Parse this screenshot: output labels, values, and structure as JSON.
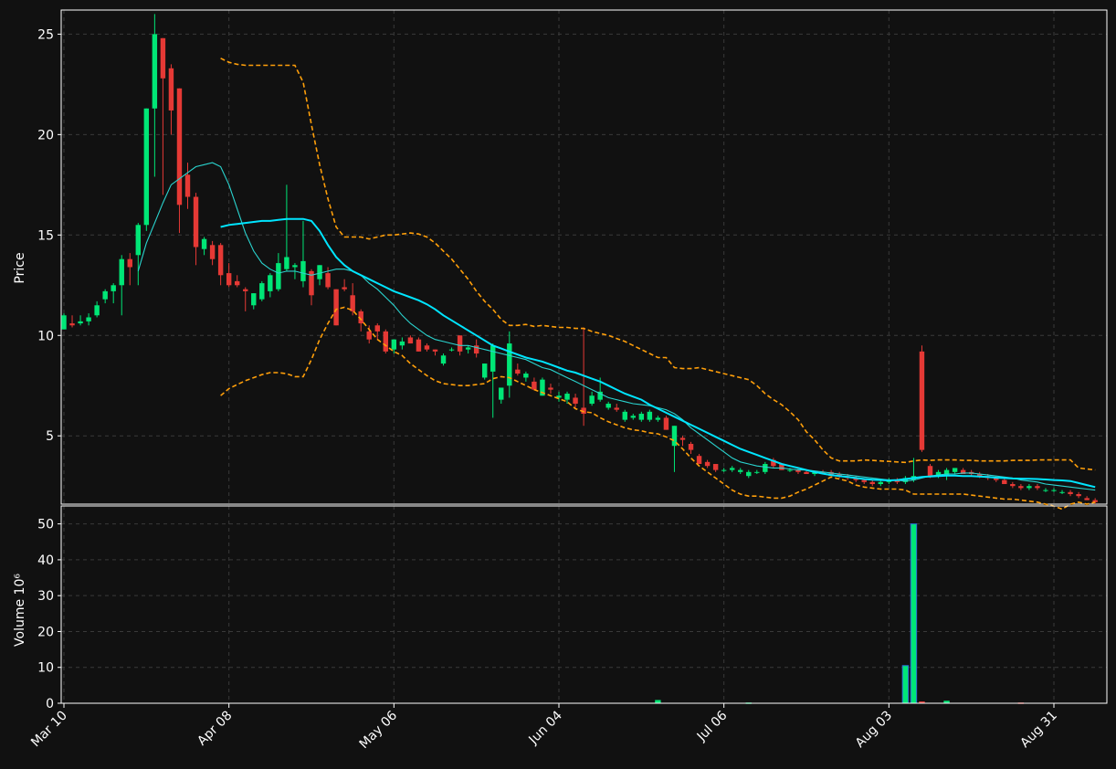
{
  "colors": {
    "background": "#111111",
    "up": "#00e676",
    "down": "#e53935",
    "ma_short": "#2ad4cf",
    "ma_long": "#00e5ff",
    "bands": "#ff9f0a",
    "grid": "#3a3a3a",
    "axis": "#ffffff"
  },
  "chart_data": [
    {
      "type": "candlestick",
      "title": "",
      "ylabel": "Price",
      "ylim": [
        1.6,
        26.2
      ],
      "yticks": [
        5,
        10,
        15,
        20,
        25
      ],
      "x_tick_labels": [
        "Mar 10",
        "Apr 08",
        "May 06",
        "Jun 04",
        "Jul 06",
        "Aug 03",
        "Aug 31"
      ],
      "x_tick_index": [
        0,
        20,
        40,
        60,
        80,
        100,
        120
      ],
      "grid": true,
      "candles": [
        [
          10.3,
          11.1,
          10.3,
          11.0
        ],
        [
          10.6,
          11.0,
          10.4,
          10.5
        ],
        [
          10.6,
          11.0,
          10.5,
          10.7
        ],
        [
          10.7,
          11.1,
          10.5,
          10.9
        ],
        [
          11.0,
          11.7,
          10.9,
          11.5
        ],
        [
          11.8,
          12.3,
          11.6,
          12.2
        ],
        [
          12.2,
          12.6,
          11.6,
          12.5
        ],
        [
          12.5,
          14.0,
          11.0,
          13.8
        ],
        [
          13.8,
          14.1,
          12.5,
          13.4
        ],
        [
          14.0,
          15.6,
          12.5,
          15.5
        ],
        [
          15.5,
          21.3,
          15.2,
          21.3
        ],
        [
          21.3,
          26.0,
          17.9,
          25.0
        ],
        [
          24.8,
          24.8,
          17.0,
          22.8
        ],
        [
          23.3,
          23.5,
          20.0,
          21.2
        ],
        [
          22.3,
          22.3,
          15.1,
          16.5
        ],
        [
          18.0,
          18.6,
          16.3,
          16.9
        ],
        [
          16.9,
          17.1,
          13.5,
          14.4
        ],
        [
          14.3,
          14.9,
          14.0,
          14.8
        ],
        [
          14.5,
          14.7,
          13.5,
          13.8
        ],
        [
          14.5,
          14.6,
          12.5,
          13.0
        ],
        [
          13.1,
          13.6,
          12.4,
          12.5
        ],
        [
          12.7,
          13.0,
          12.4,
          12.5
        ],
        [
          12.3,
          12.4,
          11.2,
          12.2
        ],
        [
          11.5,
          12.1,
          11.3,
          12.1
        ],
        [
          11.8,
          12.7,
          11.7,
          12.6
        ],
        [
          12.2,
          13.1,
          11.9,
          13.0
        ],
        [
          12.3,
          14.1,
          12.2,
          13.6
        ],
        [
          13.3,
          17.5,
          13.2,
          13.9
        ],
        [
          13.4,
          13.6,
          12.8,
          13.5
        ],
        [
          12.7,
          15.7,
          12.4,
          13.7
        ],
        [
          13.2,
          13.3,
          11.5,
          12.0
        ],
        [
          12.8,
          13.5,
          12.5,
          13.5
        ],
        [
          13.1,
          13.4,
          12.3,
          12.4
        ],
        [
          12.3,
          12.3,
          10.5,
          10.5
        ],
        [
          12.4,
          12.8,
          12.2,
          12.3
        ],
        [
          12.0,
          12.6,
          11.0,
          11.2
        ],
        [
          11.2,
          11.3,
          10.2,
          10.6
        ],
        [
          10.2,
          10.5,
          9.6,
          9.8
        ],
        [
          10.5,
          10.6,
          9.8,
          10.2
        ],
        [
          10.2,
          10.3,
          9.1,
          9.2
        ],
        [
          9.3,
          9.8,
          9.1,
          9.8
        ],
        [
          9.5,
          9.9,
          9.3,
          9.7
        ],
        [
          9.9,
          10.0,
          9.6,
          9.6
        ],
        [
          9.8,
          9.9,
          9.2,
          9.2
        ],
        [
          9.5,
          9.6,
          9.2,
          9.3
        ],
        [
          9.3,
          9.3,
          9.0,
          9.2
        ],
        [
          8.6,
          9.1,
          8.5,
          9.0
        ],
        [
          9.3,
          9.4,
          9.2,
          9.3
        ],
        [
          10.0,
          10.0,
          9.0,
          9.2
        ],
        [
          9.3,
          9.5,
          9.1,
          9.4
        ],
        [
          9.5,
          9.8,
          8.9,
          9.1
        ],
        [
          7.9,
          8.6,
          7.8,
          8.6
        ],
        [
          8.2,
          9.6,
          5.9,
          9.5
        ],
        [
          6.8,
          7.0,
          6.6,
          7.4
        ],
        [
          7.5,
          10.2,
          6.9,
          9.6
        ],
        [
          8.3,
          8.6,
          8.0,
          8.1
        ],
        [
          7.9,
          8.2,
          7.7,
          8.1
        ],
        [
          7.7,
          7.9,
          7.3,
          7.3
        ],
        [
          7.0,
          7.9,
          7.0,
          7.8
        ],
        [
          7.4,
          7.6,
          7.1,
          7.3
        ],
        [
          6.9,
          7.2,
          6.7,
          7.0
        ],
        [
          6.8,
          7.2,
          6.6,
          7.1
        ],
        [
          6.9,
          7.1,
          6.4,
          6.6
        ],
        [
          6.4,
          10.4,
          5.5,
          6.1
        ],
        [
          6.6,
          7.2,
          6.5,
          7.0
        ],
        [
          6.8,
          7.9,
          6.7,
          7.2
        ],
        [
          6.4,
          6.7,
          6.3,
          6.6
        ],
        [
          6.4,
          6.6,
          6.2,
          6.3
        ],
        [
          5.8,
          6.3,
          5.7,
          6.2
        ],
        [
          5.9,
          6.1,
          5.8,
          6.0
        ],
        [
          5.8,
          6.2,
          5.7,
          6.1
        ],
        [
          5.8,
          6.3,
          5.7,
          6.2
        ],
        [
          5.8,
          6.0,
          5.7,
          5.9
        ],
        [
          5.9,
          6.0,
          5.3,
          5.3
        ],
        [
          4.5,
          5.5,
          3.2,
          5.5
        ],
        [
          4.9,
          5.0,
          4.5,
          4.8
        ],
        [
          4.6,
          4.7,
          4.1,
          4.3
        ],
        [
          4.0,
          4.1,
          3.6,
          3.6
        ],
        [
          3.7,
          3.8,
          3.4,
          3.5
        ],
        [
          3.6,
          3.6,
          3.2,
          3.3
        ],
        [
          3.3,
          3.4,
          3.2,
          3.3
        ],
        [
          3.3,
          3.5,
          3.2,
          3.4
        ],
        [
          3.2,
          3.4,
          3.1,
          3.3
        ],
        [
          3.0,
          3.3,
          2.9,
          3.2
        ],
        [
          3.2,
          3.3,
          3.1,
          3.2
        ],
        [
          3.2,
          3.7,
          3.1,
          3.6
        ],
        [
          3.8,
          3.9,
          3.4,
          3.5
        ],
        [
          3.6,
          3.6,
          3.3,
          3.3
        ],
        [
          3.3,
          3.4,
          3.2,
          3.3
        ],
        [
          3.3,
          3.4,
          3.1,
          3.2
        ],
        [
          3.2,
          3.3,
          3.1,
          3.1
        ],
        [
          3.1,
          3.2,
          3.0,
          3.2
        ],
        [
          3.2,
          3.3,
          3.1,
          3.1
        ],
        [
          3.2,
          3.3,
          3.0,
          3.0
        ],
        [
          3.1,
          3.2,
          2.9,
          3.0
        ],
        [
          3.0,
          3.1,
          2.8,
          2.9
        ],
        [
          2.9,
          3.0,
          2.7,
          2.8
        ],
        [
          2.8,
          2.9,
          2.6,
          2.7
        ],
        [
          2.7,
          2.8,
          2.5,
          2.6
        ],
        [
          2.6,
          2.8,
          2.5,
          2.7
        ],
        [
          2.7,
          2.9,
          2.6,
          2.8
        ],
        [
          2.8,
          2.9,
          2.6,
          2.7
        ],
        [
          2.7,
          3.0,
          2.6,
          2.9
        ],
        [
          2.8,
          3.9,
          2.7,
          3.0
        ],
        [
          9.2,
          9.5,
          4.2,
          4.3
        ],
        [
          3.5,
          3.6,
          2.9,
          3.0
        ],
        [
          3.0,
          3.3,
          2.9,
          3.2
        ],
        [
          3.0,
          3.4,
          2.8,
          3.3
        ],
        [
          3.2,
          3.4,
          3.1,
          3.4
        ],
        [
          3.3,
          3.4,
          3.1,
          3.1
        ],
        [
          3.2,
          3.3,
          3.0,
          3.1
        ],
        [
          3.1,
          3.2,
          2.9,
          3.0
        ],
        [
          3.0,
          3.1,
          2.8,
          2.9
        ],
        [
          2.9,
          3.0,
          2.7,
          2.8
        ],
        [
          2.8,
          2.9,
          2.6,
          2.6
        ],
        [
          2.6,
          2.7,
          2.4,
          2.5
        ],
        [
          2.5,
          2.6,
          2.3,
          2.4
        ],
        [
          2.4,
          2.6,
          2.3,
          2.5
        ],
        [
          2.5,
          2.6,
          2.3,
          2.4
        ],
        [
          2.3,
          2.4,
          2.2,
          2.3
        ],
        [
          2.3,
          2.4,
          2.2,
          2.3
        ],
        [
          2.2,
          2.3,
          2.1,
          2.2
        ],
        [
          2.2,
          2.3,
          2.0,
          2.1
        ],
        [
          2.1,
          2.2,
          1.9,
          2.0
        ],
        [
          1.9,
          2.0,
          1.8,
          1.8
        ],
        [
          1.8,
          1.9,
          1.6,
          1.7
        ]
      ],
      "ma_short": [
        null,
        null,
        null,
        null,
        null,
        null,
        null,
        null,
        null,
        13.2,
        14.6,
        15.6,
        16.6,
        17.5,
        17.8,
        18.1,
        18.4,
        18.5,
        18.6,
        18.4,
        17.5,
        16.3,
        15.1,
        14.2,
        13.6,
        13.3,
        13.1,
        13.2,
        13.2,
        13.1,
        13.0,
        13.1,
        13.2,
        13.3,
        13.3,
        13.2,
        13.0,
        12.6,
        12.3,
        11.9,
        11.5,
        11.0,
        10.6,
        10.3,
        10.0,
        9.8,
        9.7,
        9.6,
        9.5,
        9.5,
        9.4,
        9.3,
        9.2,
        9.1,
        9.0,
        8.9,
        8.8,
        8.6,
        8.4,
        8.3,
        8.1,
        7.9,
        7.7,
        7.5,
        7.3,
        7.1,
        6.9,
        6.8,
        6.7,
        6.6,
        6.55,
        6.5,
        6.4,
        6.3,
        6.1,
        5.8,
        5.4,
        5.1,
        4.8,
        4.5,
        4.2,
        3.9,
        3.7,
        3.6,
        3.5,
        3.45,
        3.4,
        3.4,
        3.35,
        3.3,
        3.3,
        3.25,
        3.2,
        3.15,
        3.1,
        3.05,
        3.0,
        2.95,
        2.9,
        2.85,
        2.8,
        2.78,
        2.75,
        2.8,
        2.9,
        3.0,
        3.05,
        3.1,
        3.1,
        3.15,
        3.15,
        3.1,
        3.05,
        3.0,
        2.95,
        2.9,
        2.8,
        2.75,
        2.7,
        2.6,
        2.55,
        2.5,
        2.45,
        2.4,
        2.35,
        2.3
      ],
      "ma_long": [
        null,
        null,
        null,
        null,
        null,
        null,
        null,
        null,
        null,
        null,
        null,
        null,
        null,
        null,
        null,
        null,
        null,
        null,
        null,
        15.4,
        15.5,
        15.55,
        15.6,
        15.65,
        15.7,
        15.7,
        15.75,
        15.8,
        15.8,
        15.8,
        15.7,
        15.2,
        14.5,
        13.9,
        13.5,
        13.2,
        13.0,
        12.8,
        12.6,
        12.4,
        12.2,
        12.05,
        11.9,
        11.75,
        11.55,
        11.3,
        11.0,
        10.75,
        10.5,
        10.25,
        10.0,
        9.75,
        9.5,
        9.35,
        9.2,
        9.05,
        8.9,
        8.8,
        8.7,
        8.55,
        8.4,
        8.25,
        8.15,
        8.0,
        7.85,
        7.7,
        7.5,
        7.3,
        7.1,
        6.95,
        6.8,
        6.55,
        6.35,
        6.15,
        5.95,
        5.75,
        5.55,
        5.35,
        5.15,
        4.95,
        4.75,
        4.55,
        4.35,
        4.2,
        4.05,
        3.9,
        3.75,
        3.6,
        3.5,
        3.4,
        3.3,
        3.2,
        3.12,
        3.05,
        3.0,
        2.95,
        2.9,
        2.85,
        2.82,
        2.8,
        2.78,
        2.8,
        2.85,
        2.9,
        2.95,
        2.98,
        3.0,
        3.02,
        3.02,
        3.0,
        3.0,
        2.98,
        2.95,
        2.92,
        2.9,
        2.88,
        2.87,
        2.86,
        2.85,
        2.83,
        2.8,
        2.78,
        2.75,
        2.65,
        2.55,
        2.45
      ],
      "band_upper": [
        null,
        null,
        null,
        null,
        null,
        null,
        null,
        null,
        null,
        null,
        null,
        null,
        null,
        null,
        null,
        null,
        null,
        null,
        null,
        23.8,
        23.6,
        23.5,
        23.45,
        23.45,
        23.45,
        23.45,
        23.45,
        23.45,
        23.45,
        22.6,
        20.5,
        18.5,
        16.8,
        15.4,
        14.9,
        14.9,
        14.9,
        14.8,
        14.9,
        15.0,
        15.0,
        15.05,
        15.1,
        15.05,
        14.9,
        14.6,
        14.2,
        13.8,
        13.3,
        12.8,
        12.2,
        11.7,
        11.3,
        10.8,
        10.5,
        10.5,
        10.55,
        10.45,
        10.5,
        10.45,
        10.4,
        10.4,
        10.35,
        10.35,
        10.2,
        10.1,
        10.0,
        9.85,
        9.7,
        9.5,
        9.3,
        9.1,
        8.9,
        8.9,
        8.4,
        8.35,
        8.35,
        8.4,
        8.3,
        8.2,
        8.1,
        8.0,
        7.9,
        7.8,
        7.5,
        7.1,
        6.8,
        6.55,
        6.2,
        5.8,
        5.2,
        4.8,
        4.3,
        3.9,
        3.75,
        3.75,
        3.75,
        3.8,
        3.78,
        3.75,
        3.73,
        3.7,
        3.68,
        3.75,
        3.8,
        3.78,
        3.8,
        3.8,
        3.8,
        3.78,
        3.78,
        3.75,
        3.75,
        3.75,
        3.75,
        3.78,
        3.78,
        3.78,
        3.8,
        3.8,
        3.8,
        3.8,
        3.8,
        3.4,
        3.35,
        3.3
      ],
      "band_lower": [
        null,
        null,
        null,
        null,
        null,
        null,
        null,
        null,
        null,
        null,
        null,
        null,
        null,
        null,
        null,
        null,
        null,
        null,
        null,
        7.0,
        7.35,
        7.55,
        7.75,
        7.9,
        8.05,
        8.15,
        8.15,
        8.1,
        7.95,
        7.95,
        8.8,
        9.8,
        10.6,
        11.3,
        11.4,
        11.25,
        10.8,
        10.3,
        9.8,
        9.5,
        9.2,
        9.0,
        8.6,
        8.3,
        8.0,
        7.75,
        7.6,
        7.55,
        7.5,
        7.5,
        7.55,
        7.6,
        7.85,
        7.95,
        7.9,
        7.7,
        7.5,
        7.3,
        7.15,
        7.0,
        6.85,
        6.7,
        6.35,
        6.2,
        6.15,
        5.9,
        5.7,
        5.55,
        5.4,
        5.3,
        5.25,
        5.15,
        5.1,
        4.95,
        4.75,
        4.35,
        3.9,
        3.5,
        3.2,
        2.9,
        2.6,
        2.3,
        2.1,
        2.0,
        2.0,
        1.95,
        1.9,
        1.9,
        2.0,
        2.2,
        2.35,
        2.55,
        2.75,
        2.95,
        2.85,
        2.75,
        2.55,
        2.45,
        2.4,
        2.35,
        2.35,
        2.35,
        2.3,
        2.1,
        2.1,
        2.1,
        2.1,
        2.1,
        2.1,
        2.1,
        2.05,
        2.0,
        1.95,
        1.9,
        1.85,
        1.85,
        1.8,
        1.75,
        1.7,
        1.6,
        1.5,
        1.35,
        1.6,
        1.7,
        1.6,
        1.7
      ]
    },
    {
      "type": "bar",
      "ylabel": "Volume",
      "ylabel_exponent": "10⁶",
      "ylim": [
        0,
        50
      ],
      "yticks": [
        0,
        10,
        20,
        30,
        40,
        50
      ],
      "grid": true,
      "volumes": [
        [
          72,
          0.9
        ],
        [
          102,
          10.5
        ],
        [
          103,
          52.0
        ],
        [
          104,
          0.5
        ],
        [
          107,
          0.7
        ],
        [
          116,
          0.2
        ],
        [
          83,
          0.2
        ]
      ]
    }
  ]
}
